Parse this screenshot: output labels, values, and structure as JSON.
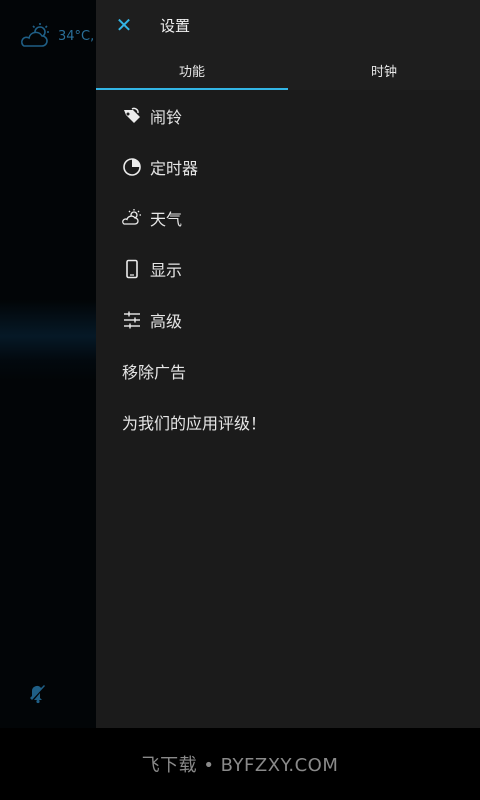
{
  "background": {
    "temperature": "34°C,"
  },
  "header": {
    "close_label": "✕",
    "title": "设置"
  },
  "tabs": [
    {
      "label": "功能",
      "active": true
    },
    {
      "label": "时钟",
      "active": false
    }
  ],
  "menu": {
    "items": [
      {
        "label": "闹铃",
        "icon": "alarm-tag-icon"
      },
      {
        "label": "定时器",
        "icon": "timer-icon"
      },
      {
        "label": "天气",
        "icon": "weather-icon"
      },
      {
        "label": "显示",
        "icon": "phone-display-icon"
      },
      {
        "label": "高级",
        "icon": "sliders-icon"
      },
      {
        "label": "移除广告",
        "icon": ""
      },
      {
        "label": "为我们的应用评级！",
        "icon": ""
      }
    ]
  },
  "watermark": "飞下载 • BYFZXY.COM",
  "colors": {
    "accent": "#33b5e5",
    "drawer_bg": "#1b1b1b",
    "text": "#e6e6e6"
  }
}
